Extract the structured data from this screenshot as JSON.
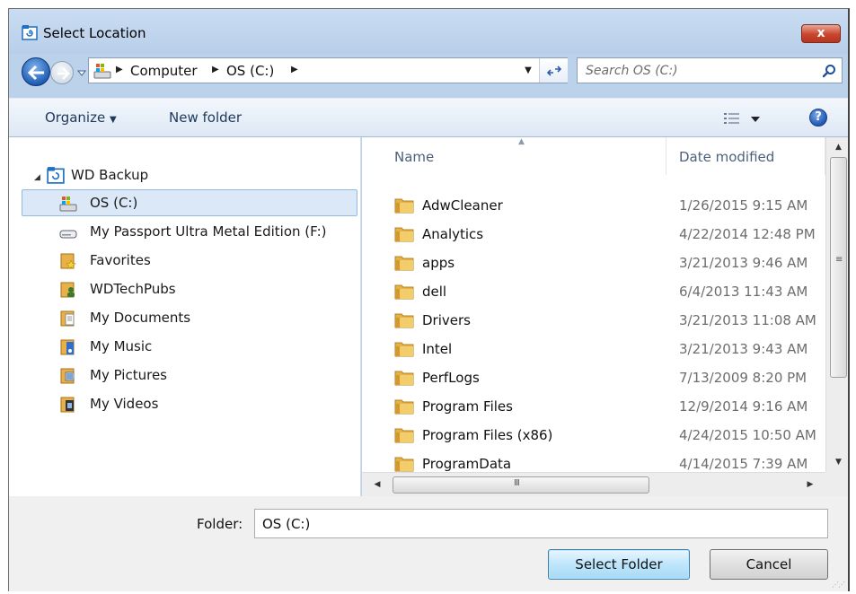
{
  "window": {
    "title": "Select Location",
    "close_glyph": "x"
  },
  "nav": {
    "breadcrumbs": [
      "Computer",
      "OS (C:)"
    ],
    "search_placeholder": "Search OS (C:)"
  },
  "toolbar": {
    "organize_label": "Organize",
    "new_folder_label": "New folder"
  },
  "tree": {
    "root": "WD Backup",
    "items": [
      {
        "label": "OS (C:)",
        "icon": "drive-icon",
        "selected": true
      },
      {
        "label": "My Passport Ultra Metal Edition (F:)",
        "icon": "external-drive-icon"
      },
      {
        "label": "Favorites",
        "icon": "favorites-folder-icon"
      },
      {
        "label": "WDTechPubs",
        "icon": "user-folder-icon"
      },
      {
        "label": "My Documents",
        "icon": "documents-icon"
      },
      {
        "label": "My Music",
        "icon": "music-icon"
      },
      {
        "label": "My Pictures",
        "icon": "pictures-icon"
      },
      {
        "label": "My Videos",
        "icon": "videos-icon"
      }
    ]
  },
  "list": {
    "col_name": "Name",
    "col_date": "Date modified",
    "rows": [
      {
        "name": "AdwCleaner",
        "date": "1/26/2015 9:15 AM"
      },
      {
        "name": "Analytics",
        "date": "4/22/2014 12:48 PM"
      },
      {
        "name": "apps",
        "date": "3/21/2013 9:46 AM"
      },
      {
        "name": "dell",
        "date": "6/4/2013 11:43 AM"
      },
      {
        "name": "Drivers",
        "date": "3/21/2013 11:08 AM"
      },
      {
        "name": "Intel",
        "date": "3/21/2013 9:43 AM"
      },
      {
        "name": "PerfLogs",
        "date": "7/13/2009 8:20 PM"
      },
      {
        "name": "Program Files",
        "date": "12/9/2014 9:16 AM"
      },
      {
        "name": "Program Files (x86)",
        "date": "4/24/2015 10:50 AM"
      },
      {
        "name": "ProgramData",
        "date": "4/14/2015 7:39 AM"
      }
    ]
  },
  "footer": {
    "folder_label": "Folder:",
    "folder_value": "OS (C:)",
    "select_label": "Select Folder",
    "cancel_label": "Cancel"
  }
}
